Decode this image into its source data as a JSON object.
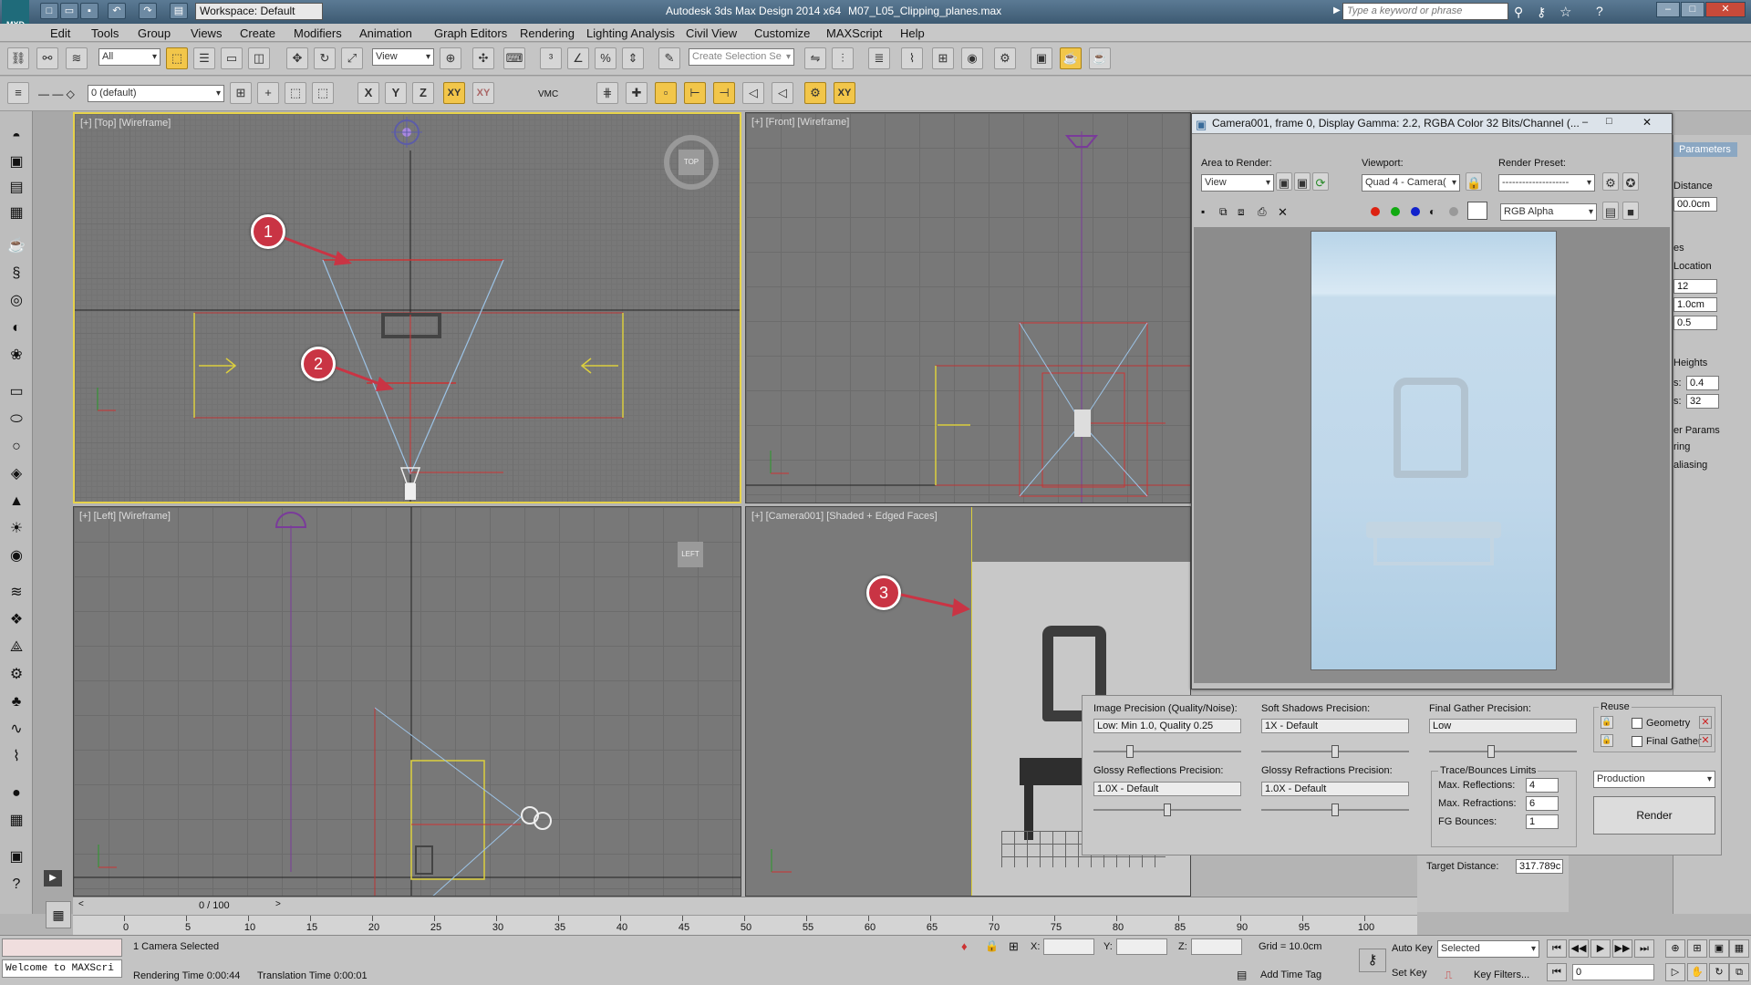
{
  "title_bar": {
    "app_title": "Autodesk 3ds Max Design 2014 x64",
    "file_name": "M07_L05_Clipping_planes.max",
    "workspace": "Workspace: Default",
    "search_placeholder": "Type a keyword or phrase",
    "logo_text": "MXD"
  },
  "menu": [
    "Edit",
    "Tools",
    "Group",
    "Views",
    "Create",
    "Modifiers",
    "Animation",
    "Graph Editors",
    "Rendering",
    "Lighting Analysis",
    "Civil View",
    "Customize",
    "MAXScript",
    "Help"
  ],
  "main_toolbar": {
    "filter": "All",
    "ref_coord": "View",
    "selection_set_placeholder": "Create Selection Se"
  },
  "second_toolbar": {
    "layer": "0 (default)",
    "axis_x": "X",
    "axis_y": "Y",
    "axis_z": "Z",
    "axis_xy": "XY",
    "axis_xy2": "XY",
    "vmc": "VMC"
  },
  "viewports": {
    "top": "[+] [Top] [Wireframe]",
    "front": "[+] [Front] [Wireframe]",
    "left": "[+] [Left] [Wireframe]",
    "camera": "[+] [Camera001] [Shaded + Edged Faces]",
    "viewcube_top": "TOP",
    "viewcube_left": "LEFT"
  },
  "callouts": [
    "1",
    "2",
    "3"
  ],
  "render_frame": {
    "title": "Camera001, frame 0, Display Gamma: 2.2, RGBA Color 32 Bits/Channel (...",
    "area_to_render_label": "Area to Render:",
    "area_to_render": "View",
    "viewport_label": "Viewport:",
    "viewport": "Quad 4 - Camera(",
    "render_preset_label": "Render Preset:",
    "render_preset": "--------------------",
    "channel": "RGB Alpha"
  },
  "render_settings": {
    "image_precision_label": "Image Precision (Quality/Noise):",
    "image_precision": "Low: Min 1.0, Quality 0.25",
    "soft_shadows_label": "Soft Shadows Precision:",
    "soft_shadows": "1X - Default",
    "final_gather_label": "Final Gather Precision:",
    "final_gather": "Low",
    "glossy_reflections_label": "Glossy Reflections Precision:",
    "glossy_reflections": "1.0X - Default",
    "glossy_refractions_label": "Glossy Refractions Precision:",
    "glossy_refractions": "1.0X - Default",
    "reuse_label": "Reuse",
    "geometry_label": "Geometry",
    "final_gather_reuse_label": "Final Gather",
    "trace_label": "Trace/Bounces Limits",
    "max_reflections_label": "Max. Reflections:",
    "max_reflections": "4",
    "max_refractions_label": "Max. Refractions:",
    "max_refractions": "6",
    "fg_bounces_label": "FG Bounces:",
    "fg_bounces": "1",
    "preset": "Production",
    "render_button": "Render"
  },
  "command_panel": {
    "tab": "Parameters",
    "distance_label": "Distance",
    "distance": "00.0cm",
    "es_label": "es",
    "location_label": "Location",
    "v1": "12",
    "v2": "1.0cm",
    "v3": "0.5",
    "heights_label": "Heights",
    "h1_label": "s:",
    "h1": "0.4",
    "h2_label": "s:",
    "h2": "32",
    "params_label": "er Params",
    "ring_label": "ring",
    "aliasing_label": "aliasing",
    "target_distance_label": "Target Distance:",
    "target_distance": "317.789c"
  },
  "timeline": {
    "frame": "0 / 100",
    "ticks": [
      "0",
      "5",
      "10",
      "15",
      "20",
      "25",
      "30",
      "35",
      "40",
      "45",
      "50",
      "55",
      "60",
      "65",
      "70",
      "75",
      "80",
      "85",
      "90",
      "95",
      "100"
    ]
  },
  "status": {
    "welcome": "Welcome to MAXScri",
    "selection": "1 Camera Selected",
    "rendering_time": "Rendering Time 0:00:44",
    "translation_time": "Translation Time 0:00:01",
    "x_label": "X:",
    "y_label": "Y:",
    "z_label": "Z:",
    "grid": "Grid = 10.0cm",
    "add_time_tag": "Add Time Tag",
    "auto_key": "Auto Key",
    "set_key": "Set Key",
    "selected": "Selected",
    "key_filters": "Key Filters...",
    "frame_field": "0"
  }
}
